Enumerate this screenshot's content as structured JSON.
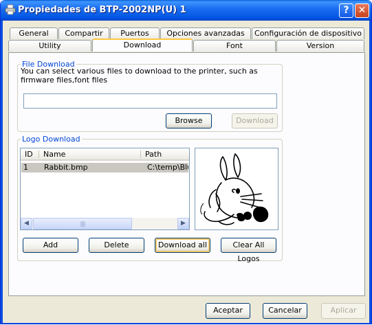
{
  "window": {
    "title": "Propiedades de BTP-2002NP(U) 1",
    "help_label": "?",
    "close_label": "✕"
  },
  "tabs": {
    "row1": [
      "General",
      "Compartir",
      "Puertos",
      "Opciones avanzadas",
      "Configuración de dispositivo"
    ],
    "row2": [
      "Utility",
      "Download",
      "Font",
      "Version"
    ],
    "active": "Download"
  },
  "file_download": {
    "legend": "File Download",
    "description": "You can select various files to download to the printer, such as firmware files,font files",
    "path_value": "",
    "browse_label": "Browse",
    "download_label": "Download"
  },
  "logo_download": {
    "legend": "Logo Download",
    "columns": [
      "ID",
      "Name",
      "Path"
    ],
    "rows": [
      {
        "id": "1",
        "name": "Rabbit.bmp",
        "path": "C:\\temp\\Blue"
      }
    ],
    "scroll_left": "◀",
    "scroll_right": "▶",
    "scroll_grip": "||||",
    "add_label": "Add",
    "delete_label": "Delete",
    "download_all_label": "Download all",
    "clear_all_label": "Clear All Logos"
  },
  "footer": {
    "accept_label": "Aceptar",
    "cancel_label": "Cancelar",
    "apply_label": "Aplicar"
  },
  "colors": {
    "titlebar": "#0054e3",
    "group_legend": "#0046d5",
    "active_tab_accent": "#ffc83c",
    "selected_row": "#c9c7c0"
  }
}
